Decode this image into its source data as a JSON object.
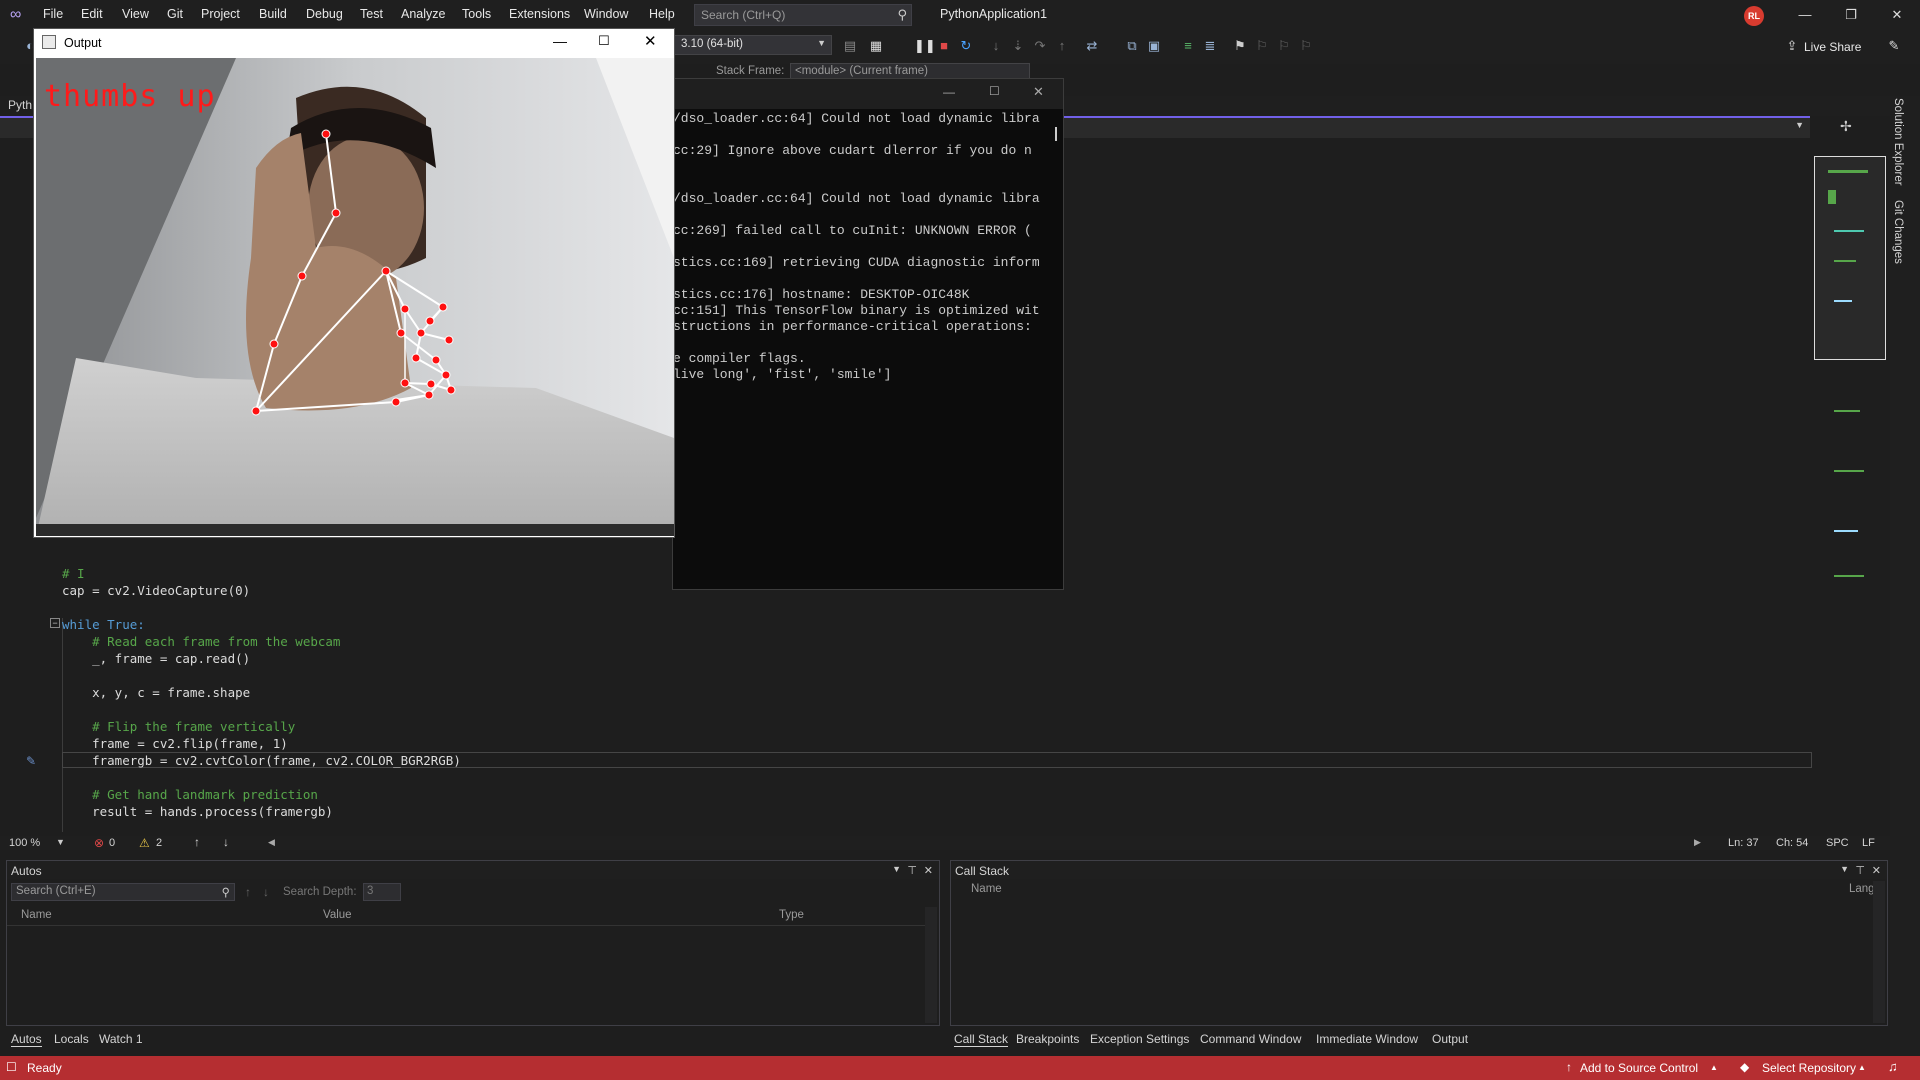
{
  "menubar": {
    "items": [
      "File",
      "Edit",
      "View",
      "Git",
      "Project",
      "Build",
      "Debug",
      "Test",
      "Analyze",
      "Tools",
      "Extensions",
      "Window",
      "Help"
    ],
    "search_placeholder": "Search (Ctrl+Q)",
    "project_name": "PythonApplication1",
    "avatar_initials": "RL"
  },
  "toolbar": {
    "environment": "3.10 (64-bit)",
    "live_share": "Live Share",
    "stack_frame_label": "Stack Frame:",
    "stack_frame_value": "<module> (Current frame)"
  },
  "side_tabs": [
    "Solution Explorer",
    "Git Changes"
  ],
  "editor": {
    "tab_partial": "Pyth",
    "lines": [
      {
        "text": "# I",
        "kind": "cm"
      },
      {
        "text": "cap = cv2.VideoCapture(0)",
        "kind": "id"
      },
      {
        "text": "",
        "kind": "id"
      },
      {
        "text": "while True:",
        "kind": "kw"
      },
      {
        "text": "    # Read each frame from the webcam",
        "kind": "cm"
      },
      {
        "text": "    _, frame = cap.read()",
        "kind": "id"
      },
      {
        "text": "",
        "kind": "id"
      },
      {
        "text": "    x, y, c = frame.shape",
        "kind": "id"
      },
      {
        "text": "",
        "kind": "id"
      },
      {
        "text": "    # Flip the frame vertically",
        "kind": "cm"
      },
      {
        "text": "    frame = cv2.flip(frame, 1)",
        "kind": "id"
      },
      {
        "text": "    framergb = cv2.cvtColor(frame, cv2.COLOR_BGR2RGB)",
        "kind": "id"
      },
      {
        "text": "",
        "kind": "id"
      },
      {
        "text": "    # Get hand landmark prediction",
        "kind": "cm"
      },
      {
        "text": "    result = hands.process(framergb)",
        "kind": "id"
      }
    ]
  },
  "editor_status": {
    "zoom": "100 %",
    "errors": "0",
    "warnings": "2",
    "line": "Ln: 37",
    "col": "Ch: 54",
    "whitespace": "SPC",
    "eol": "LF"
  },
  "autos": {
    "title": "Autos",
    "search_placeholder": "Search (Ctrl+E)",
    "depth_label": "Search Depth:",
    "depth_value": "3",
    "columns": [
      "Name",
      "Value",
      "Type"
    ]
  },
  "callstack": {
    "title": "Call Stack",
    "columns": [
      "Name",
      "Lang"
    ]
  },
  "bottom_tabs_left": [
    "Autos",
    "Locals",
    "Watch 1"
  ],
  "bottom_tabs_right": [
    "Call Stack",
    "Breakpoints",
    "Exception Settings",
    "Command Window",
    "Immediate Window",
    "Output"
  ],
  "statusbar": {
    "ready": "Ready",
    "add_source": "Add to Source Control",
    "select_repo": "Select Repository"
  },
  "console": {
    "lines": [
      "/dso_loader.cc:64] Could not load dynamic libra",
      "cc:29] Ignore above cudart dlerror if you do n",
      "",
      "",
      "/dso_loader.cc:64] Could not load dynamic libra",
      "",
      "cc:269] failed call to cuInit: UNKNOWN ERROR (",
      "",
      "stics.cc:169] retrieving CUDA diagnostic inform",
      "",
      "stics.cc:176] hostname: DESKTOP-OIC48K",
      "cc:151] This TensorFlow binary is optimized wit",
      "structions in performance-critical operations:",
      "",
      "e compiler flags.",
      "live long', 'fist', 'smile']"
    ]
  },
  "output_window": {
    "title": "Output",
    "gesture": "thumbs up"
  }
}
